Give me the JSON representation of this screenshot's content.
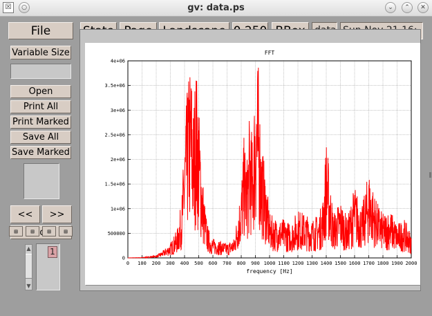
{
  "window": {
    "title": "gv: data.ps",
    "app_icon": "gv-icon",
    "controls": [
      "chevron-down-icon",
      "chevron-up-icon",
      "close-icon"
    ]
  },
  "toolbar": {
    "file": "File",
    "state": "State",
    "page": "Page",
    "orientation": "Landscape",
    "scale": "0.250",
    "media": "BBox",
    "filename": "data",
    "date": "Sun Nov 21 16:"
  },
  "sidebar": {
    "variable_size": "Variable Size",
    "open": "Open",
    "print_all": "Print All",
    "print_marked": "Print Marked",
    "save_all": "Save All",
    "save_marked": "Save Marked",
    "prev": "<<",
    "next": ">>",
    "reload": "Reload",
    "orientation_icons": [
      "orientation-portrait-icon",
      "orientation-landscape-icon",
      "orientation-upside-down-icon",
      "orientation-seascape-icon"
    ],
    "current_page": "1"
  },
  "chart_data": {
    "type": "line",
    "title": "FFT",
    "xlabel": "frequency [Hz]",
    "ylabel": "",
    "xlim": [
      0,
      2000
    ],
    "ylim": [
      0,
      4000000
    ],
    "grid": true,
    "line_color": "#ff0000",
    "x_ticks": [
      "0",
      "100",
      "200",
      "300",
      "400",
      "500",
      "600",
      "700",
      "800",
      "900",
      "1000",
      "1100",
      "1200",
      "1300",
      "1400",
      "1500",
      "1600",
      "1700",
      "1800",
      "1900",
      "2000"
    ],
    "y_ticks": [
      "0",
      "500000",
      "1e+06",
      "1.5e+06",
      "2e+06",
      "2.5e+06",
      "3e+06",
      "3.5e+06",
      "4e+06"
    ],
    "series": [
      {
        "x": [
          0,
          100,
          200,
          250,
          300,
          350,
          380,
          400,
          420,
          440,
          450,
          460,
          480,
          500,
          520,
          540,
          560,
          580,
          600,
          650,
          700,
          750,
          800,
          820,
          840,
          860,
          880,
          900,
          920,
          940,
          960,
          980,
          1000,
          1050,
          1100,
          1150,
          1200,
          1250,
          1300,
          1350,
          1380,
          1400,
          1420,
          1450,
          1500,
          1550,
          1600,
          1650,
          1700,
          1750,
          1800,
          1850,
          1900,
          1950,
          2000
        ],
        "y": [
          0,
          10000,
          50000,
          150000,
          300000,
          600000,
          1200000,
          2500000,
          3500000,
          4000000,
          3800000,
          3000000,
          4000000,
          3200000,
          2000000,
          1200000,
          700000,
          500000,
          400000,
          350000,
          300000,
          400000,
          1500000,
          2500000,
          2000000,
          3000000,
          2400000,
          3900000,
          4000000,
          2500000,
          2000000,
          1500000,
          900000,
          800000,
          800000,
          700000,
          1000000,
          900000,
          800000,
          900000,
          1300000,
          2500000,
          1800000,
          900000,
          1200000,
          800000,
          1500000,
          1000000,
          1800000,
          1200000,
          900000,
          1000000,
          700000,
          800000,
          500000
        ]
      }
    ]
  }
}
